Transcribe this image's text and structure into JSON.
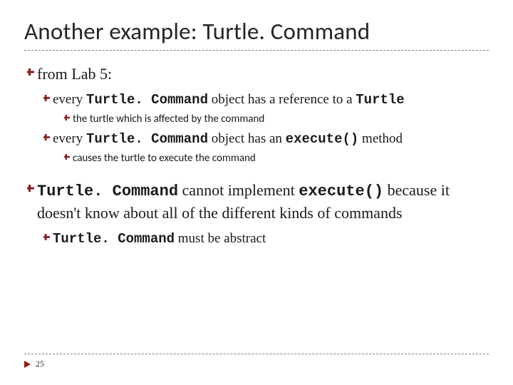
{
  "title": "Another example: Turtle. Command",
  "bullets": {
    "b1": "from Lab 5:",
    "b1a_pre": "every ",
    "b1a_code1": "Turtle. Command",
    "b1a_mid": " object has a reference to a ",
    "b1a_code2": "Turtle",
    "b1a_i": "the turtle which is affected by the command",
    "b1b_pre": "every ",
    "b1b_code1": "Turtle. Command",
    "b1b_mid": " object has an ",
    "b1b_code2": "execute()",
    "b1b_post": " method",
    "b1b_i": "causes the turtle to execute the command",
    "b2_code1": "Turtle. Command",
    "b2_mid1": " cannot implement ",
    "b2_code2": "execute()",
    "b2_post": " because it doesn't know about all of the different kinds of commands",
    "b2a_code": "Turtle. Command",
    "b2a_post": " must be abstract"
  },
  "page_number": "25"
}
